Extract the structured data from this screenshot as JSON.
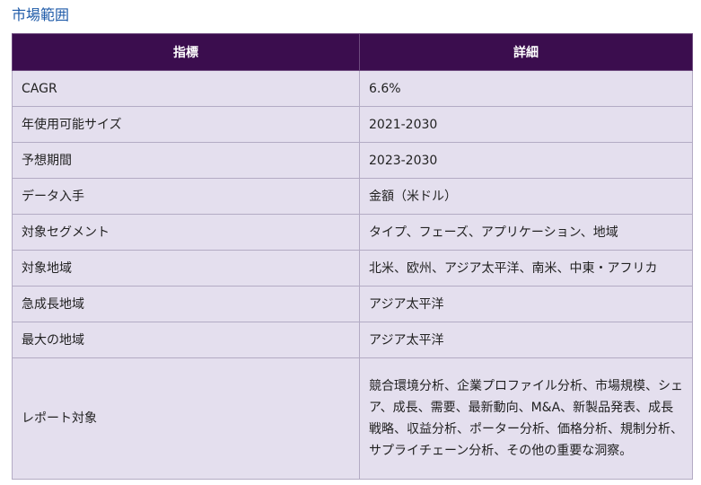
{
  "section": {
    "title": "市場範囲"
  },
  "table": {
    "headers": [
      "指標",
      "詳細"
    ],
    "rows": [
      {
        "metric": "CAGR",
        "detail": "6.6%"
      },
      {
        "metric": "年使用可能サイズ",
        "detail": "2021-2030"
      },
      {
        "metric": "予想期間",
        "detail": "2023-2030"
      },
      {
        "metric": "データ入手",
        "detail": "金額（米ドル）"
      },
      {
        "metric": "対象セグメント",
        "detail": "タイプ、フェーズ、アプリケーション、地域"
      },
      {
        "metric": "対象地域",
        "detail": "北米、欧州、アジア太平洋、南米、中東・アフリカ"
      },
      {
        "metric": "急成長地域",
        "detail": "アジア太平洋"
      },
      {
        "metric": "最大の地域",
        "detail": "アジア太平洋"
      },
      {
        "metric": "レポート対象",
        "detail": "競合環境分析、企業プロファイル分析、市場規模、シェア、成長、需要、最新動向、M&A、新製品発表、成長戦略、収益分析、ポーター分析、価格分析、規制分析、サプライチェーン分析、その他の重要な洞察。"
      }
    ]
  },
  "colors": {
    "title": "#1e5aa8",
    "header_bg": "#3b0d4e",
    "cell_bg": "#e4dfee",
    "border": "#b3abc4"
  }
}
